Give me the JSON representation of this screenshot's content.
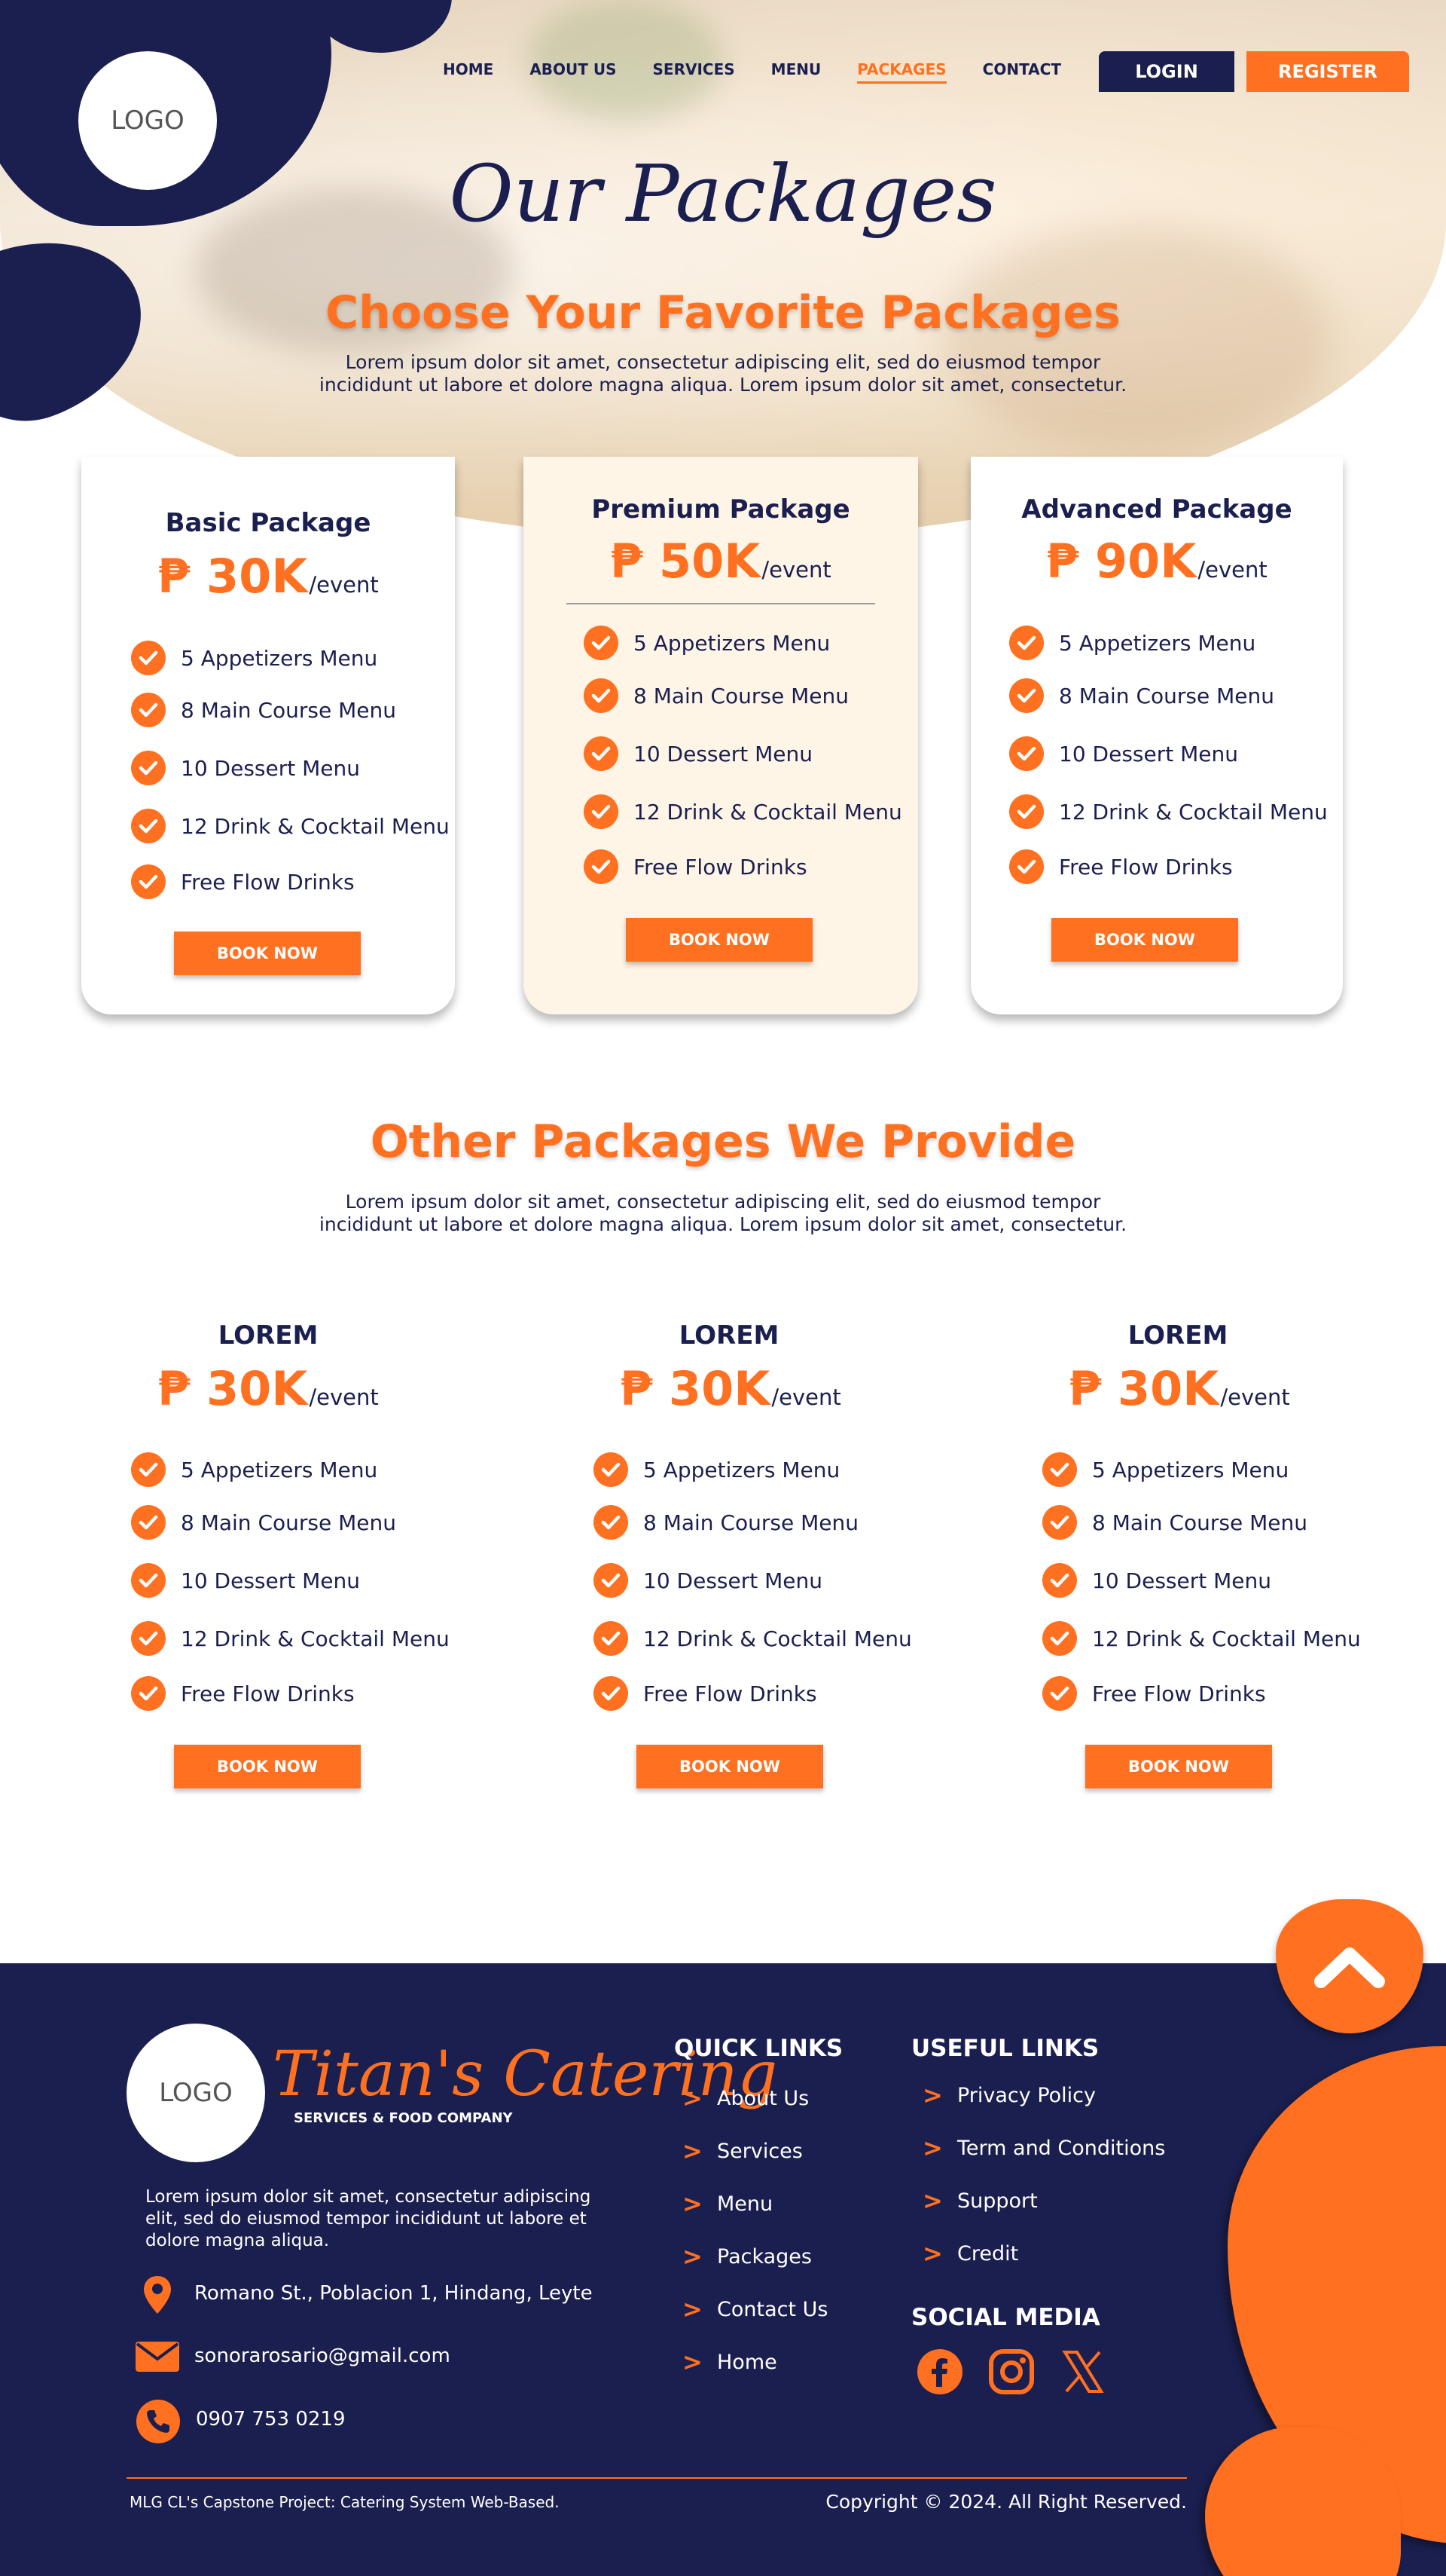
{
  "colors": {
    "navy": "#1b1f4f",
    "orange": "#ff7020",
    "premium_bg": "#fff5e6"
  },
  "header": {
    "logo_text": "LOGO",
    "nav": [
      "HOME",
      "ABOUT US",
      "SERVICES",
      "MENU",
      "PACKAGES",
      "CONTACT"
    ],
    "active_nav": "PACKAGES",
    "login_label": "LOGIN",
    "register_label": "REGISTER"
  },
  "hero": {
    "script_title": "Our Packages",
    "heading": "Choose Your Favorite Packages",
    "lead_line1": "Lorem ipsum dolor sit amet, consectetur adipiscing elit, sed do eiusmod tempor",
    "lead_line2": "incididunt ut labore et dolore magna aliqua. Lorem ipsum dolor sit amet, consectetur."
  },
  "packages": [
    {
      "title": "Basic Package",
      "price": "₱ 30K",
      "per": "/event",
      "features": [
        "5 Appetizers Menu",
        "8 Main Course Menu",
        "10 Dessert Menu",
        "12 Drink & Cocktail Menu",
        "Free Flow Drinks"
      ],
      "button": "BOOK NOW"
    },
    {
      "title": "Premium Package",
      "price": "₱ 50K",
      "per": "/event",
      "features": [
        "5 Appetizers Menu",
        "8 Main Course Menu",
        "10 Dessert Menu",
        "12 Drink & Cocktail Menu",
        "Free Flow Drinks"
      ],
      "button": "BOOK NOW"
    },
    {
      "title": "Advanced Package",
      "price": "₱ 90K",
      "per": "/event",
      "features": [
        "5 Appetizers Menu",
        "8 Main Course Menu",
        "10 Dessert Menu",
        "12 Drink & Cocktail Menu",
        "Free Flow Drinks"
      ],
      "button": "BOOK NOW"
    }
  ],
  "other": {
    "heading": "Other Packages We Provide",
    "lead_line1": "Lorem ipsum dolor sit amet, consectetur adipiscing elit, sed do eiusmod tempor",
    "lead_line2": "incididunt ut labore et dolore magna aliqua. Lorem ipsum dolor sit amet, consectetur.",
    "items": [
      {
        "title": "LOREM",
        "price": "₱ 30K",
        "per": "/event",
        "features": [
          "5 Appetizers Menu",
          "8 Main Course Menu",
          "10 Dessert Menu",
          "12 Drink & Cocktail Menu",
          "Free Flow Drinks"
        ],
        "button": "BOOK NOW"
      },
      {
        "title": "LOREM",
        "price": "₱ 30K",
        "per": "/event",
        "features": [
          "5 Appetizers Menu",
          "8 Main Course Menu",
          "10 Dessert Menu",
          "12 Drink & Cocktail Menu",
          "Free Flow Drinks"
        ],
        "button": "BOOK NOW"
      },
      {
        "title": "LOREM",
        "price": "₱ 30K",
        "per": "/event",
        "features": [
          "5 Appetizers Menu",
          "8 Main Course Menu",
          "10 Dessert Menu",
          "12 Drink & Cocktail Menu",
          "Free Flow Drinks"
        ],
        "button": "BOOK NOW"
      }
    ]
  },
  "footer": {
    "logo_text": "LOGO",
    "brand": "Titan's Catering",
    "brand_sub": "SERVICES & FOOD COMPANY",
    "about_line1": "Lorem ipsum dolor sit amet, consectetur adipiscing",
    "about_line2": "elit, sed do eiusmod tempor incididunt ut labore et",
    "about_line3": "dolore magna aliqua.",
    "address": "Romano St., Poblacion 1, Hindang, Leyte",
    "email": "sonorarosario@gmail.com",
    "phone": "0907 753 0219",
    "quick_links_title": "QUICK LINKS",
    "quick_links": [
      "About Us",
      "Services",
      "Menu",
      "Packages",
      "Contact Us",
      "Home"
    ],
    "useful_links_title": "USEFUL LINKS",
    "useful_links": [
      "Privacy Policy",
      "Term and Conditions",
      "Support",
      "Credit"
    ],
    "social_title": "SOCIAL MEDIA",
    "social_icons": [
      "facebook-icon",
      "instagram-icon",
      "x-twitter-icon"
    ],
    "bottom_left": "MLG CL's Capstone Project: Catering System Web-Based.",
    "bottom_right": "Copyright © 2024. All Right Reserved."
  }
}
